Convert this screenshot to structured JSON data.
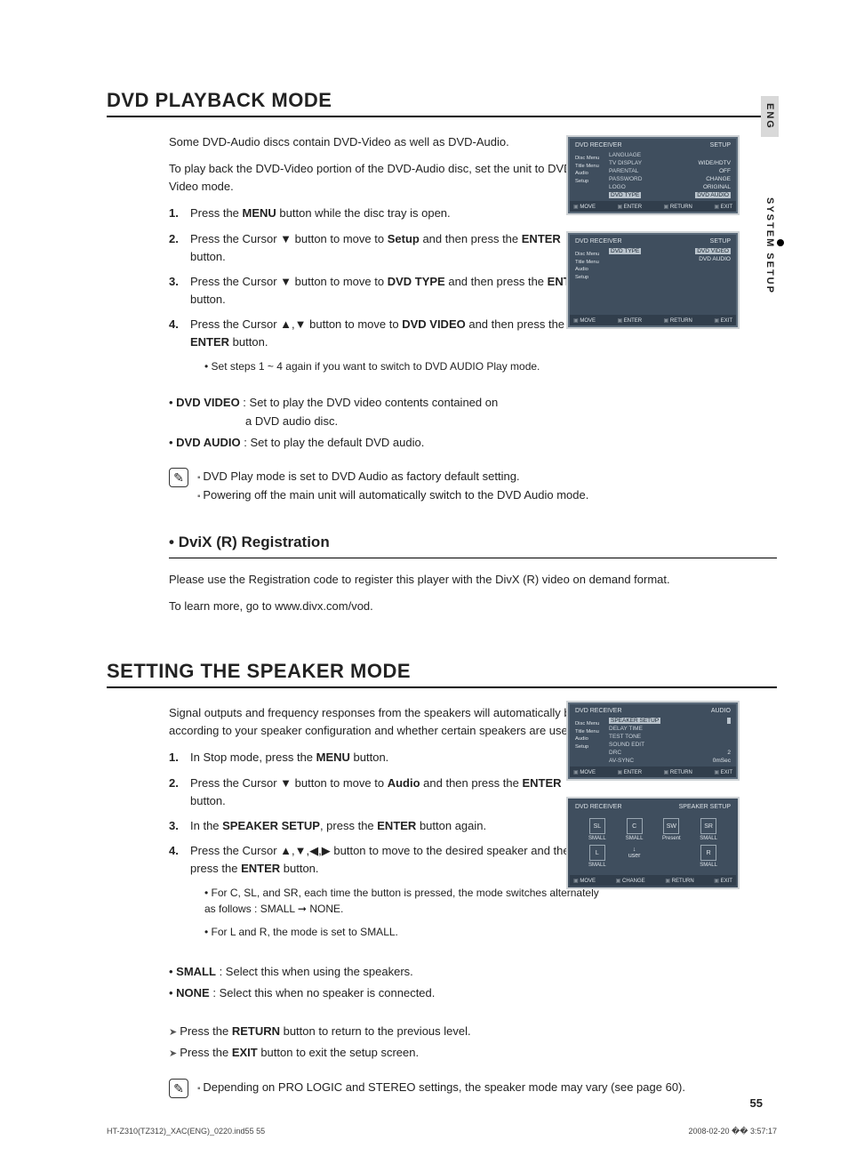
{
  "sideTabs": {
    "eng": "ENG",
    "sys": "SYSTEM SETUP"
  },
  "sec1": {
    "title": "DVD PLAYBACK MODE",
    "intro1": "Some DVD-Audio discs contain DVD-Video as well as DVD-Audio.",
    "intro2": "To play back the DVD-Video portion of the DVD-Audio disc, set the unit to DVD-Video mode.",
    "steps": {
      "s1": "Press the MENU button while the disc tray is open.",
      "s2": "Press the Cursor ▼ button to move to Setup and then press the ENTER button.",
      "s3": "Press the Cursor ▼ button to move to DVD TYPE and then press the ENTER button.",
      "s4": "Press the Cursor ▲,▼ button to move to DVD VIDEO and then press the ENTER button.",
      "s4sub": "Set steps 1 ~ 4 again if you want to switch to DVD AUDIO Play mode."
    },
    "opts": {
      "video": "DVD VIDEO : Set to play the DVD video contents contained on a DVD audio disc.",
      "audio": "DVD AUDIO : Set to play the default DVD audio."
    },
    "notes": {
      "n1": "DVD Play mode is set to DVD Audio as factory default setting.",
      "n2": "Powering off the main unit will automatically switch to the DVD Audio mode."
    },
    "divx": {
      "title": "DviX (R) Registration",
      "p1": "Please use the Registration code to register this player with the DivX (R) video on demand format.",
      "p2": "To learn more, go to www.divx.com/vod."
    }
  },
  "sec2": {
    "title": "SETTING THE SPEAKER MODE",
    "intro": "Signal outputs and frequency responses from the speakers will automatically be adjusted according to your speaker configuration and whether certain speakers are used or not.",
    "steps": {
      "s1": "In Stop mode, press the MENU button.",
      "s2": "Press the Cursor ▼ button to move to Audio and then press the ENTER button.",
      "s3": "In the SPEAKER SETUP, press the ENTER button again.",
      "s4": "Press the Cursor ▲,▼,◀,▶ button to move to the desired speaker and then press the ENTER button.",
      "s4sub1": "For C, SL, and SR, each time the button is pressed, the mode switches alternately as follows : SMALL ➞ NONE.",
      "s4sub2": "For L and R, the mode is set to SMALL."
    },
    "opts": {
      "small": "SMALL : Select this when using the speakers.",
      "none": "NONE : Select this when no speaker is connected."
    },
    "arrows": {
      "a1": "Press the RETURN button to return to the previous level.",
      "a2": "Press the EXIT button to exit the setup screen."
    },
    "note": "Depending on PRO LOGIC and STEREO settings, the speaker mode may vary (see page 60)."
  },
  "osd": {
    "brand": "DVD RECEIVER",
    "screen1": {
      "header": "SETUP",
      "tabs": [
        "Disc Menu",
        "Title Menu",
        "Audio",
        "Setup"
      ],
      "rows": [
        {
          "l": "LANGUAGE",
          "r": ""
        },
        {
          "l": "TV DISPLAY",
          "r": "WIDE/HDTV"
        },
        {
          "l": "PARENTAL",
          "r": "OFF"
        },
        {
          "l": "PASSWORD",
          "r": "CHANGE"
        },
        {
          "l": "LOGO",
          "r": "ORIGINAL"
        },
        {
          "l": "DVD TYPE",
          "r": "DVD AUDIO",
          "hi": true
        }
      ],
      "foot": [
        "MOVE",
        "ENTER",
        "RETURN",
        "EXIT"
      ]
    },
    "screen2": {
      "header": "SETUP",
      "tabs": [
        "Disc Menu",
        "Title Menu",
        "Audio",
        "Setup"
      ],
      "rows": [
        {
          "l": "DVD TYPE",
          "r": "DVD VIDEO",
          "hi": true
        },
        {
          "l": "",
          "r": "DVD AUDIO"
        }
      ],
      "foot": [
        "MOVE",
        "ENTER",
        "RETURN",
        "EXIT"
      ]
    },
    "screen3": {
      "header": "AUDIO",
      "tabs": [
        "Disc Menu",
        "Title Menu",
        "Audio",
        "Setup"
      ],
      "rows": [
        {
          "l": "SPEAKER SETUP",
          "r": "",
          "hi": true
        },
        {
          "l": "DELAY TIME",
          "r": ""
        },
        {
          "l": "TEST TONE",
          "r": ""
        },
        {
          "l": "SOUND EDIT",
          "r": ""
        },
        {
          "l": "DRC",
          "r": "2"
        },
        {
          "l": "AV-SYNC",
          "r": "0mSec"
        }
      ],
      "foot": [
        "MOVE",
        "ENTER",
        "RETURN",
        "EXIT"
      ]
    },
    "screen4": {
      "header": "SPEAKER SETUP",
      "cells": [
        {
          "icon": "SL",
          "label": "SMALL"
        },
        {
          "icon": "C",
          "label": "SMALL"
        },
        {
          "icon": "SW",
          "label": "Present"
        },
        {
          "icon": "SR",
          "label": "SMALL"
        },
        {
          "icon": "L",
          "label": "SMALL"
        },
        {
          "icon": "↓ user",
          "label": ""
        },
        {
          "icon": "",
          "label": ""
        },
        {
          "icon": "R",
          "label": "SMALL"
        }
      ],
      "foot": [
        "MOVE",
        "CHANGE",
        "RETURN",
        "EXIT"
      ]
    }
  },
  "pageNumber": "55",
  "footer": {
    "left": "HT-Z310(TZ312)_XAC(ENG)_0220.ind55   55",
    "right": "2008-02-20   �� 3:57:17"
  }
}
